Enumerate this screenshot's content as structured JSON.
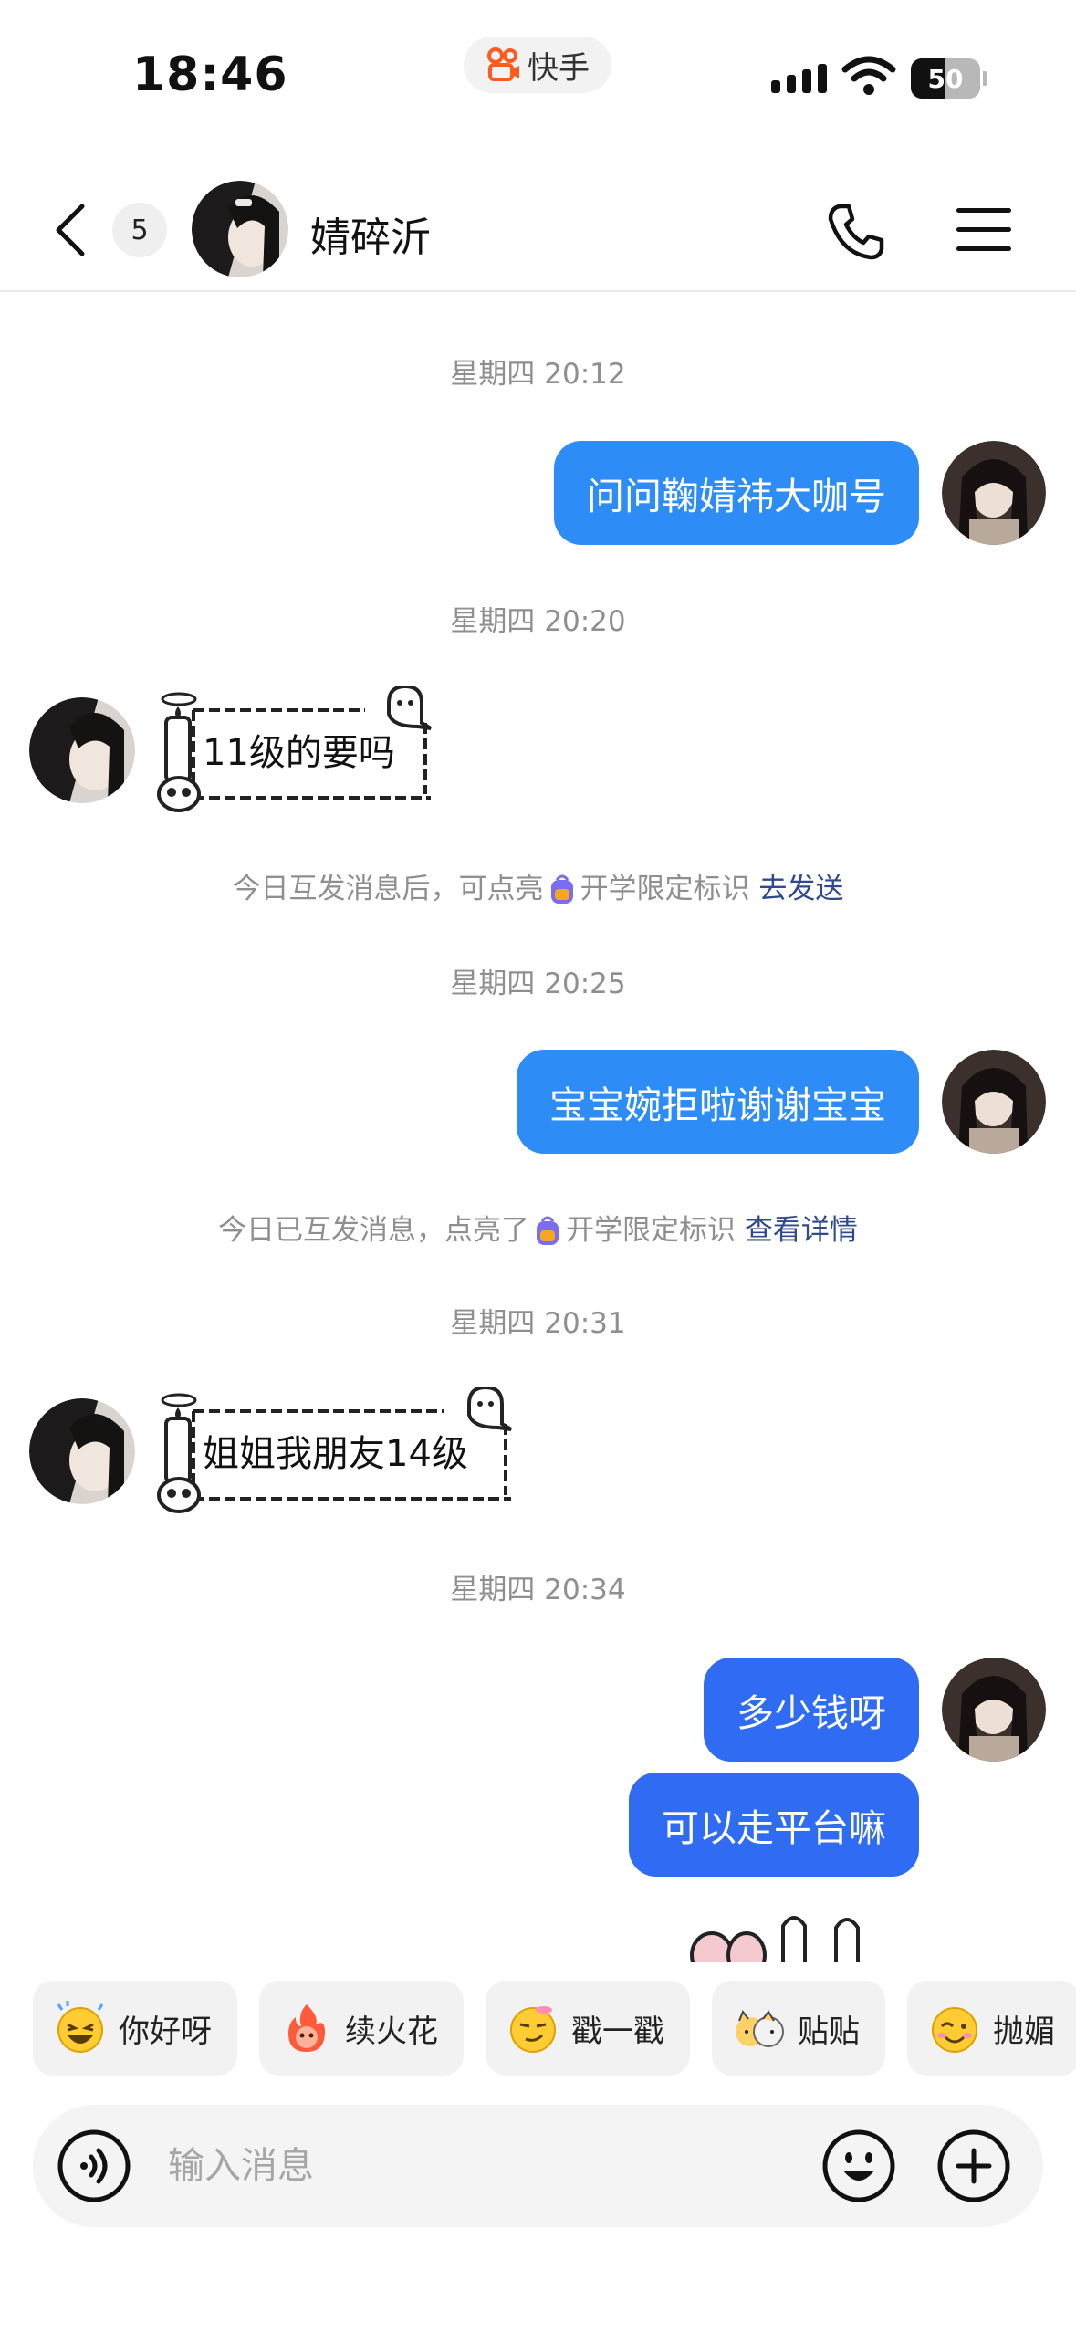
{
  "status_bar": {
    "time": "18:46",
    "app_name": "快手",
    "battery": "50",
    "battery_level": 0.5
  },
  "header": {
    "back_icon": "chevron-left-icon",
    "unread_count": "5",
    "contact_name": "婧碎沂",
    "call_icon": "phone-icon",
    "menu_icon": "menu-icon"
  },
  "messages": {
    "ts1": "星期四 20:12",
    "out1": "问问鞠婧祎大咖号",
    "ts2": "星期四 20:20",
    "in1": "11级的要吗",
    "note1": {
      "before": "今日互发消息后，可点亮",
      "after": "开学限定标识",
      "link": "去发送"
    },
    "ts3": "星期四 20:25",
    "out2": "宝宝婉拒啦谢谢宝宝",
    "note2": {
      "before": "今日已互发消息，点亮了",
      "after": "开学限定标识",
      "link": "查看详情"
    },
    "ts4": "星期四 20:31",
    "in2": "姐姐我朋友14级",
    "ts5": "星期四 20:34",
    "out3": "多少钱呀",
    "out4": "可以走平台嘛"
  },
  "quick_replies": [
    {
      "label": "你好呀",
      "icon": "laughing-emoji-icon"
    },
    {
      "label": "续火花",
      "icon": "fire-emoji-icon"
    },
    {
      "label": "戳一戳",
      "icon": "smirk-emoji-icon"
    },
    {
      "label": "贴贴",
      "icon": "cats-hug-icon"
    },
    {
      "label": "抛媚",
      "icon": "wink-emoji-icon"
    }
  ],
  "input": {
    "placeholder": "输入消息",
    "voice_icon": "voice-icon",
    "emoji_icon": "emoji-icon",
    "plus_icon": "plus-icon"
  },
  "colors": {
    "bubble_out": "#2d8cf6",
    "bubble_out_deep": "#2f6cf3",
    "link": "#2f4a8a"
  }
}
